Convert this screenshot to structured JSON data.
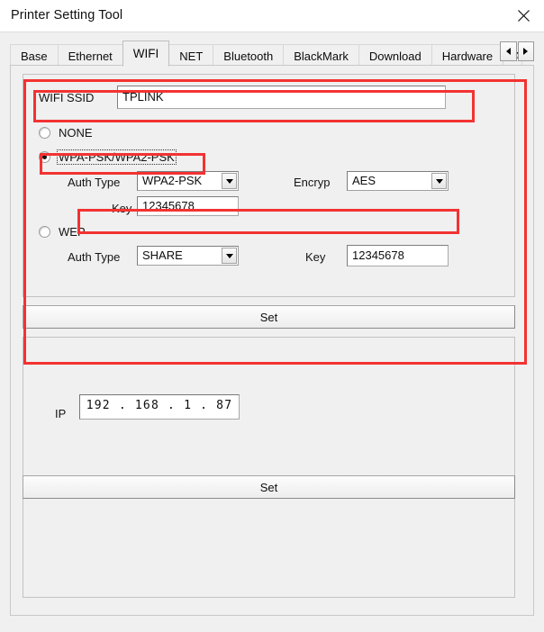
{
  "window": {
    "title": "Printer Setting Tool",
    "close_icon": "close-icon"
  },
  "tabs": {
    "items": [
      {
        "label": "Base",
        "active": false
      },
      {
        "label": "Ethernet",
        "active": false
      },
      {
        "label": "WIFI",
        "active": true
      },
      {
        "label": "NET",
        "active": false
      },
      {
        "label": "Bluetooth",
        "active": false
      },
      {
        "label": "BlackMark",
        "active": false
      },
      {
        "label": "Download",
        "active": false
      },
      {
        "label": "Hardware",
        "active": false
      },
      {
        "label": "A",
        "active": false
      }
    ],
    "scroll_left_icon": "arrow-left-icon",
    "scroll_right_icon": "arrow-right-icon"
  },
  "wifi": {
    "ssid_label": "WIFI SSID",
    "ssid_value": "TPLINK",
    "ssid_placeholder": "",
    "security": {
      "none_label": "NONE",
      "wpa_label": "WPA-PSK/WPA2-PSK",
      "wep_label": "WEP",
      "selected": "WPA-PSK/WPA2-PSK"
    },
    "wpa": {
      "auth_type_label": "Auth Type",
      "auth_type_value": "WPA2-PSK",
      "encryp_label": "Encryp",
      "encryp_value": "AES",
      "key_label": "Key",
      "key_value": "12345678"
    },
    "wep": {
      "auth_type_label": "Auth Type",
      "auth_type_value": "SHARE",
      "key_label": "Key",
      "key_value": "12345678"
    },
    "set_button_label": "Set"
  },
  "ip_section": {
    "ip_label": "IP",
    "ip_value": "192 . 168 .  1  . 87",
    "set_button_label": "Set"
  },
  "highlights": {
    "accent_color": "#f33232"
  }
}
